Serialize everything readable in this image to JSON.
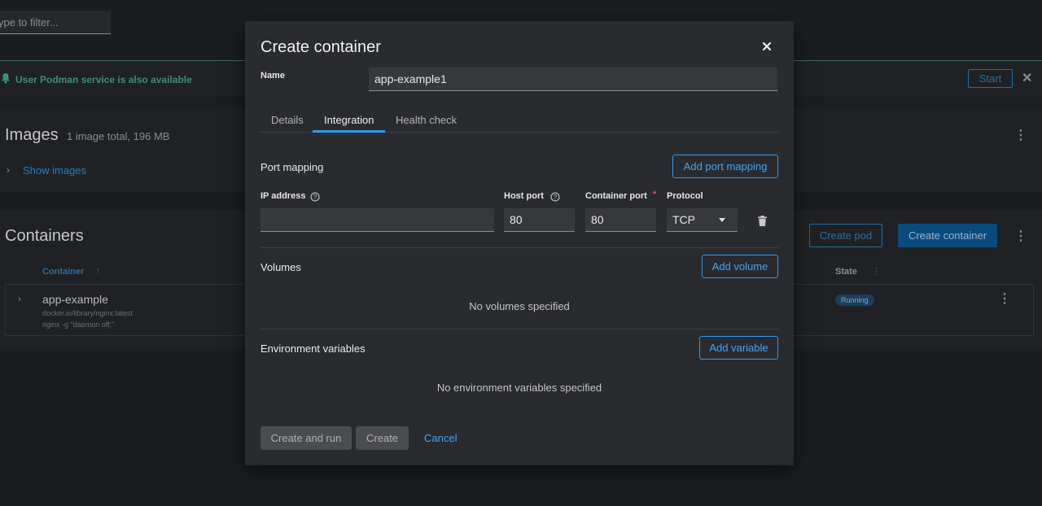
{
  "background": {
    "filter_placeholder": "ype to filter...",
    "alert_text": "User Podman service is also available",
    "start_button": "Start",
    "images_title": "Images",
    "images_summary": "1 image total, 196 MB",
    "show_images": "Show images",
    "containers_title": "Containers",
    "create_pod_button": "Create pod",
    "create_container_button": "Create container",
    "columns": {
      "container": "Container",
      "state": "State"
    },
    "row": {
      "name": "app-example",
      "image": "docker.io/library/nginx:latest",
      "command": "nginx -g \"daemon off;\"",
      "state": "Running"
    }
  },
  "modal": {
    "title": "Create container",
    "name_label": "Name",
    "name_value": "app-example1",
    "tabs": [
      "Details",
      "Integration",
      "Health check"
    ],
    "active_tab": "Integration",
    "port_mapping": {
      "title": "Port mapping",
      "add_button": "Add port mapping",
      "ip_label": "IP address",
      "host_port_label": "Host port",
      "container_port_label": "Container port",
      "protocol_label": "Protocol",
      "ip_value": "",
      "host_port_value": "80",
      "container_port_value": "80",
      "protocol_value": "TCP"
    },
    "volumes": {
      "title": "Volumes",
      "add_button": "Add volume",
      "empty": "No volumes specified"
    },
    "env": {
      "title": "Environment variables",
      "add_button": "Add variable",
      "empty": "No environment variables specified"
    },
    "footer": {
      "create_and_run": "Create and run",
      "create": "Create",
      "cancel": "Cancel"
    }
  },
  "colors": {
    "accent": "#2b9af3",
    "modal_bg": "#292b2f",
    "page_bg": "#1b1d21",
    "required": "#e05a55"
  }
}
